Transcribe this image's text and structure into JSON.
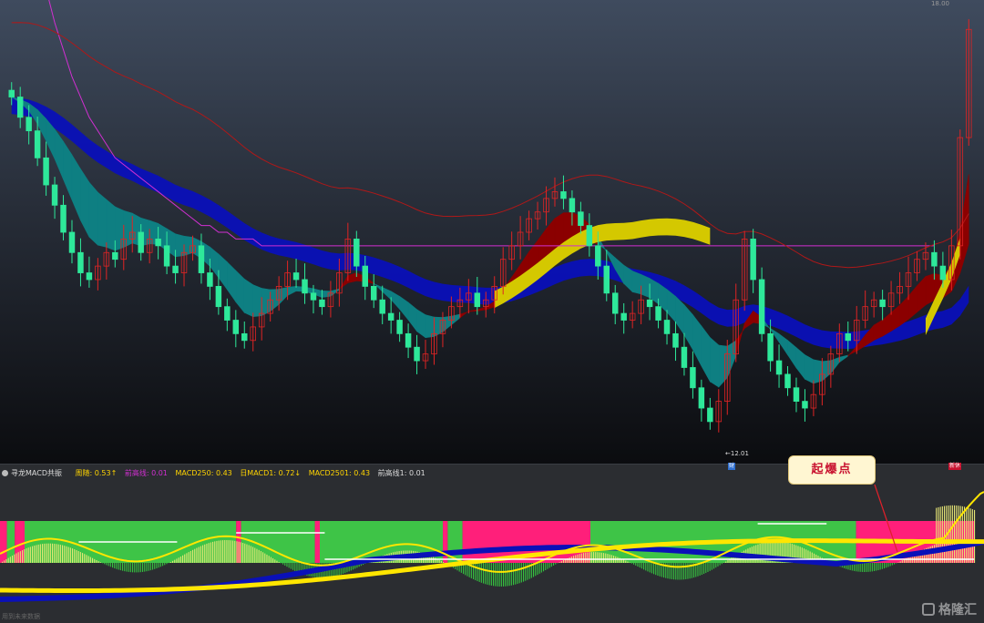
{
  "indicator": {
    "name": "寻龙MACD共振",
    "legend": [
      {
        "label": "周随: 0.53↑",
        "color": "#ffd400"
      },
      {
        "label": "前高线: 0.01",
        "color": "#d12fd1"
      },
      {
        "label": "MACD250: 0.43",
        "color": "#ffd400"
      },
      {
        "label": "日MACD1: 0.72↓",
        "color": "#ffd400"
      },
      {
        "label": "MACD2501: 0.43",
        "color": "#ffd400"
      },
      {
        "label": "前高线1: 0.01",
        "color": "#dddddd"
      }
    ]
  },
  "annotations": {
    "callout": "起爆点",
    "price_high": "18.00",
    "price_low": "←12.01",
    "low_tag": "财",
    "right_tag": "新休"
  },
  "footer_note": "用到未来数据",
  "watermark": "格隆汇",
  "colors": {
    "bull": "#e02424",
    "bear": "#2ee89a",
    "bear_band": "#0e7f82",
    "bull_band": "#8b0000",
    "slow_band": "#0a10b8",
    "yellow_band": "#d4c800",
    "pink": "#ff1f7a",
    "green": "#3ec447"
  },
  "chart_data": [
    {
      "type": "candlestick",
      "title": "",
      "note": "Overlay bands and lines on main price panel; prices estimated (range ~12.01 to 18.00).",
      "candles_close": [
        16.9,
        16.6,
        16.4,
        16.0,
        15.6,
        15.3,
        14.9,
        14.6,
        14.3,
        14.2,
        14.4,
        14.6,
        14.5,
        14.8,
        14.9,
        14.6,
        14.8,
        14.7,
        14.4,
        14.3,
        14.6,
        14.7,
        14.3,
        14.1,
        13.8,
        13.6,
        13.4,
        13.3,
        13.5,
        13.7,
        13.9,
        14.1,
        14.3,
        14.2,
        14.0,
        13.9,
        13.8,
        14.0,
        14.3,
        14.8,
        14.4,
        14.1,
        13.9,
        13.7,
        13.6,
        13.4,
        13.2,
        13.0,
        13.1,
        13.4,
        13.6,
        13.8,
        13.9,
        14.0,
        13.8,
        13.9,
        14.1,
        14.5,
        14.7,
        14.9,
        15.1,
        15.2,
        15.4,
        15.5,
        15.4,
        15.2,
        15.0,
        14.7,
        14.4,
        14.0,
        13.7,
        13.6,
        13.7,
        13.9,
        13.8,
        13.6,
        13.4,
        13.2,
        12.9,
        12.6,
        12.3,
        12.1,
        12.4,
        13.1,
        13.9,
        14.8,
        14.2,
        13.4,
        13.0,
        12.8,
        12.6,
        12.4,
        12.3,
        12.5,
        12.8,
        13.1,
        13.4,
        13.3,
        13.6,
        13.8,
        13.9,
        13.8,
        14.0,
        14.1,
        14.3,
        14.5,
        14.6,
        14.4,
        14.2,
        14.7,
        16.3,
        17.9
      ],
      "series": [
        {
          "name": "前高线",
          "color": "#d12fd1",
          "values": [
            20.5,
            20.0,
            19.5,
            19.0,
            18.5,
            18.0,
            17.6,
            17.2,
            16.9,
            16.6,
            16.4,
            16.2,
            16.0,
            15.9,
            15.8,
            15.7,
            15.6,
            15.5,
            15.4,
            15.3,
            15.2,
            15.1,
            15.0,
            15.0,
            14.9,
            14.9,
            14.8,
            14.8,
            14.8,
            14.7,
            14.7,
            14.7,
            14.7,
            14.7,
            14.7,
            14.7,
            14.7,
            14.7,
            14.7,
            14.7,
            14.7,
            14.7,
            14.7,
            14.7,
            14.7,
            14.7,
            14.7,
            14.7,
            14.7,
            14.7,
            14.7,
            14.7,
            14.7,
            14.7,
            14.7,
            14.7,
            14.7,
            14.7,
            14.7,
            14.7,
            14.7,
            14.7,
            14.7,
            14.7,
            14.7,
            14.7,
            14.7,
            14.7,
            14.7,
            14.7,
            14.7,
            14.7,
            14.7,
            14.7,
            14.7,
            14.7,
            14.7,
            14.7,
            14.7,
            14.7,
            14.7,
            14.7,
            14.7,
            14.7,
            14.7,
            14.7,
            14.7,
            14.7,
            14.7,
            14.7,
            14.7,
            14.7,
            14.7,
            14.7,
            14.7,
            14.7,
            14.7,
            14.7,
            14.7,
            14.7,
            14.7,
            14.7,
            14.7,
            14.7,
            14.7,
            14.7,
            14.7,
            14.7
          ]
        }
      ]
    },
    {
      "type": "bar",
      "title": "寻龙MACD共振",
      "note": "MACD-style histogram with regime bands; values are relative.",
      "series": [
        {
          "name": "日MACD1",
          "color": "#ffd400"
        },
        {
          "name": "MACD250",
          "color": "#ffd400"
        }
      ]
    }
  ]
}
